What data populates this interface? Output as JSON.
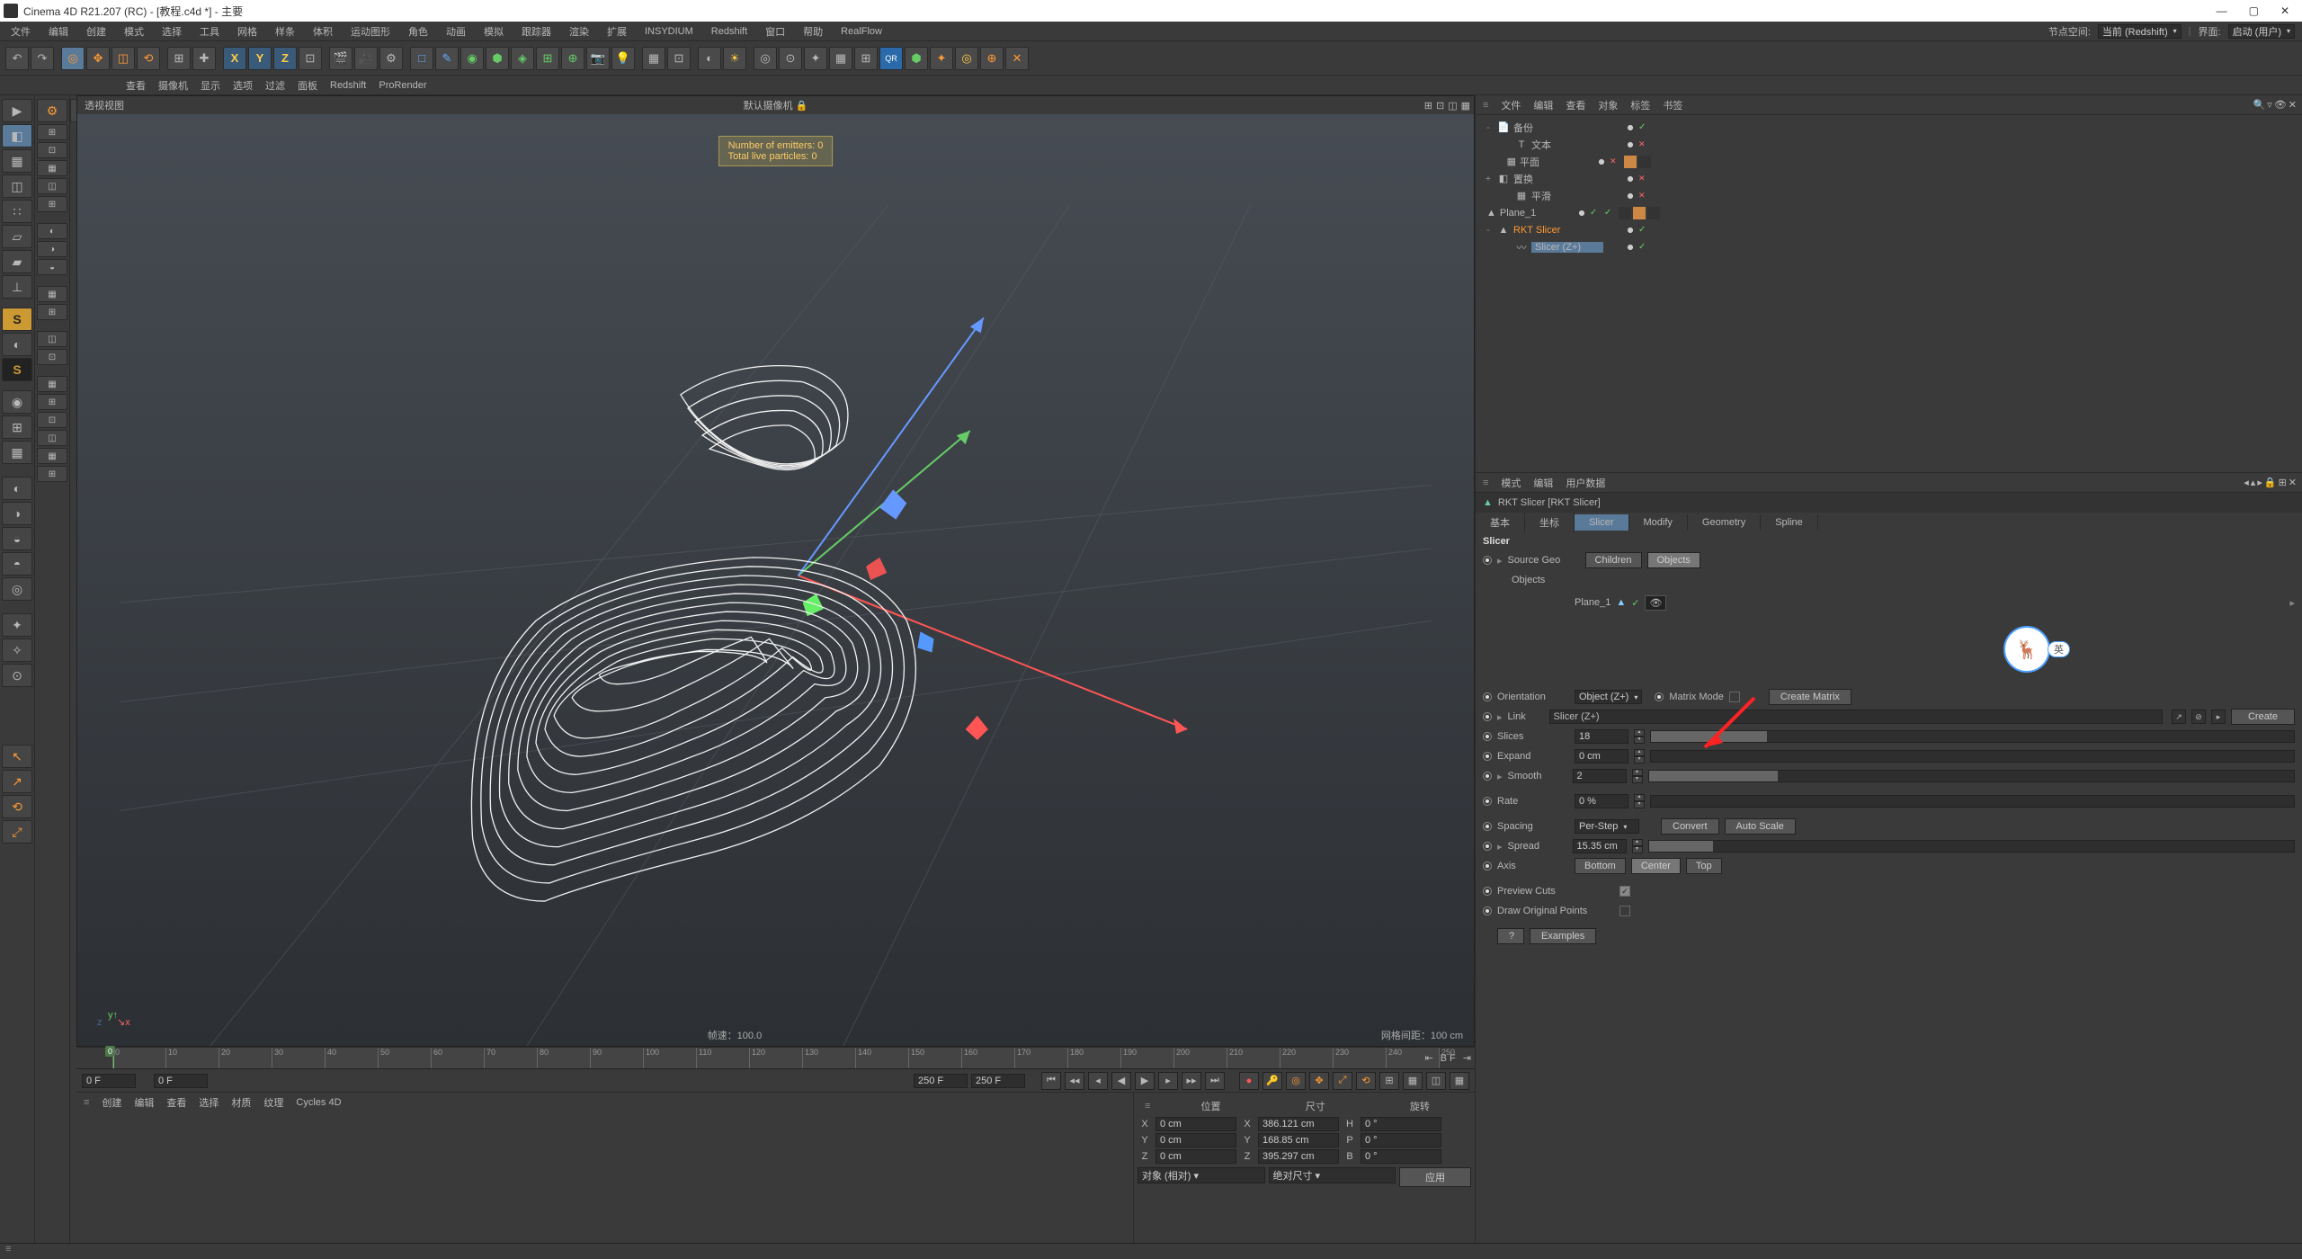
{
  "window": {
    "title": "Cinema 4D R21.207 (RC) - [教程.c4d *] - 主要",
    "menubar": [
      "文件",
      "编辑",
      "创建",
      "模式",
      "选择",
      "工具",
      "网格",
      "样条",
      "体积",
      "运动图形",
      "角色",
      "动画",
      "模拟",
      "跟踪器",
      "渲染",
      "扩展",
      "INSYDIUM",
      "Redshift",
      "窗口",
      "帮助",
      "RealFlow"
    ],
    "menubar_right_space": "节点空间:",
    "menubar_right_space_val": "当前 (Redshift)",
    "menubar_right_layout": "界面:",
    "menubar_right_layout_val": "启动 (用户)"
  },
  "subtoolbar": [
    "查看",
    "摄像机",
    "显示",
    "选项",
    "过滤",
    "面板",
    "Redshift",
    "ProRender"
  ],
  "viewport": {
    "panel_label": "透视视图",
    "camera_label": "默认摄像机",
    "hud_line1": "Number of emitters: 0",
    "hud_line2": "Total live particles: 0",
    "frame_rate": "帧速：100.0",
    "grid_spacing": "网格间距：100 cm"
  },
  "object_manager": {
    "header": [
      "文件",
      "编辑",
      "查看",
      "对象",
      "标签",
      "书签"
    ],
    "rows": [
      {
        "indent": 0,
        "toggle": "-",
        "icon": "📄",
        "name": "备份",
        "tags": [
          "white-dot",
          "green-check"
        ]
      },
      {
        "indent": 1,
        "toggle": "",
        "icon": "T",
        "name": "文本",
        "tags": [
          "white-dot",
          "red-x"
        ]
      },
      {
        "indent": 1,
        "toggle": "",
        "icon": "▦",
        "name": "平面",
        "tags": [
          "white-dot",
          "red-x",
          "orange",
          "dark"
        ]
      },
      {
        "indent": 0,
        "toggle": "+",
        "icon": "◧",
        "name": "置换",
        "tags": [
          "white-dot",
          "red-x"
        ]
      },
      {
        "indent": 1,
        "toggle": "",
        "icon": "▦",
        "name": "平滑",
        "tags": [
          "white-dot",
          "red-x"
        ]
      },
      {
        "indent": 0,
        "toggle": "",
        "icon": "▲",
        "name": "Plane_1",
        "tags": [
          "white-dot",
          "green-check",
          "green-check",
          "dark",
          "orange",
          "dark"
        ]
      },
      {
        "indent": 0,
        "toggle": "-",
        "icon": "▲",
        "name": "RKT Slicer",
        "highlight": true,
        "tags": [
          "white-dot",
          "green-check"
        ]
      },
      {
        "indent": 1,
        "toggle": "",
        "icon": "〰",
        "name": "Slicer (Z+)",
        "selected": true,
        "tags": [
          "white-dot",
          "green-check"
        ]
      }
    ]
  },
  "attribute_manager": {
    "header": [
      "模式",
      "编辑",
      "用户数据"
    ],
    "object_label": "RKT Slicer [RKT Slicer]",
    "tabs": [
      "基本",
      "坐标",
      "Slicer",
      "Modify",
      "Geometry",
      "Spline"
    ],
    "active_tab": 2,
    "section": "Slicer",
    "source_geo_label": "Source Geo",
    "source_children": "Children",
    "source_objects": "Objects",
    "objects_label": "Objects",
    "linked_object": "Plane_1",
    "orientation_label": "Orientation",
    "orientation_value": "Object (Z+)",
    "matrix_mode_label": "Matrix Mode",
    "create_matrix": "Create Matrix",
    "link_label": "Link",
    "link_value": "Slicer (Z+)",
    "create_btn": "Create",
    "slices_label": "Slices",
    "slices_value": "18",
    "expand_label": "Expand",
    "expand_value": "0 cm",
    "smooth_label": "Smooth",
    "smooth_value": "2",
    "rate_label": "Rate",
    "rate_value": "0 %",
    "spacing_label": "Spacing",
    "spacing_value": "Per-Step",
    "convert_btn": "Convert",
    "autoscale_btn": "Auto Scale",
    "spread_label": "Spread",
    "spread_value": "15.35 cm",
    "axis_label": "Axis",
    "axis_options": [
      "Bottom",
      "Center",
      "Top"
    ],
    "axis_active": 1,
    "preview_cuts_label": "Preview Cuts",
    "draw_orig_label": "Draw Original Points",
    "help_btn": "?",
    "examples_btn": "Examples"
  },
  "timeline": {
    "frame_start": "0 F",
    "frame_cur": "0 F",
    "frame_end1": "250 F",
    "frame_end2": "250 F",
    "range_label": "B F",
    "ticks": [
      "0",
      "10",
      "20",
      "30",
      "40",
      "50",
      "60",
      "70",
      "80",
      "90",
      "100",
      "110",
      "120",
      "130",
      "140",
      "150",
      "160",
      "170",
      "180",
      "190",
      "200",
      "210",
      "220",
      "230",
      "240",
      "250"
    ]
  },
  "bottom_panel_header": [
    "创建",
    "编辑",
    "查看",
    "选择",
    "材质",
    "纹理",
    "Cycles 4D"
  ],
  "coords": {
    "headers": [
      "位置",
      "尺寸",
      "旋转"
    ],
    "rows": [
      {
        "axis": "X",
        "p": "0 cm",
        "s": "386.121 cm",
        "r_lbl": "H",
        "r": "0 °"
      },
      {
        "axis": "Y",
        "p": "0 cm",
        "s": "168.85 cm",
        "r_lbl": "P",
        "r": "0 °"
      },
      {
        "axis": "Z",
        "p": "0 cm",
        "s": "395.297 cm",
        "r_lbl": "B",
        "r": "0 °"
      }
    ],
    "dropdown1": "对象 (相对)",
    "dropdown2": "绝对尺寸",
    "apply": "应用"
  },
  "floaty_label": "英"
}
